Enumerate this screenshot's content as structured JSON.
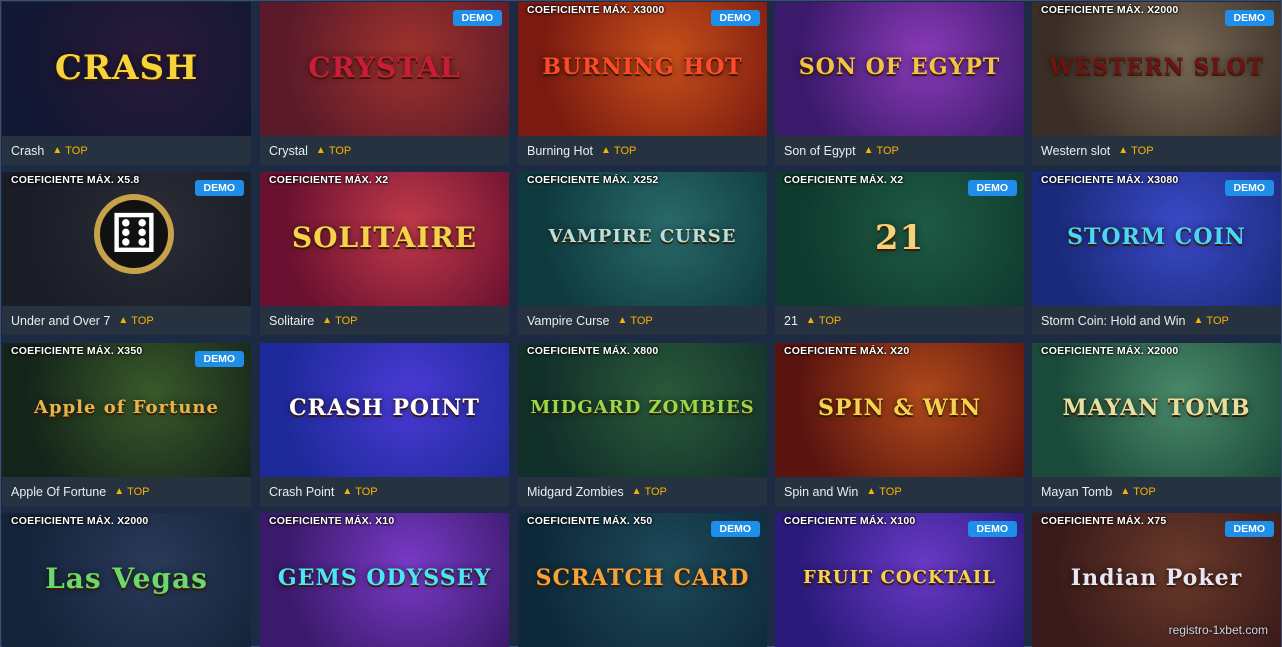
{
  "games": [
    {
      "name": "Crash",
      "badge": "TOP",
      "coef": "",
      "demo": false,
      "logo": "CRASH",
      "bg": [
        "#121733",
        "#2a1a3a"
      ],
      "logo_color": "#f6d33b"
    },
    {
      "name": "Crystal",
      "badge": "TOP",
      "coef": "",
      "demo": true,
      "logo": "CRYSTAL",
      "bg": [
        "#5a1a2a",
        "#a0322c"
      ],
      "logo_color": "#c81c3a"
    },
    {
      "name": "Burning Hot",
      "badge": "TOP",
      "coef": "COEFICIENTE MÁX. X3000",
      "demo": true,
      "logo": "BURNING HOT",
      "bg": [
        "#7a1a10",
        "#c8501a"
      ],
      "logo_color": "#ff4a2a"
    },
    {
      "name": "Son of Egypt",
      "badge": "TOP",
      "coef": "",
      "demo": false,
      "logo": "SON OF EGYPT",
      "bg": [
        "#3a1a6a",
        "#8a3ab8"
      ],
      "logo_color": "#f3c343"
    },
    {
      "name": "Western slot",
      "badge": "TOP",
      "coef": "COEFICIENTE MÁX. X2000",
      "demo": true,
      "logo": "WESTERN SLOT",
      "bg": [
        "#3a2e26",
        "#7a6a58"
      ],
      "logo_color": "#6a1414"
    },
    {
      "name": "Under and Over 7",
      "badge": "TOP",
      "coef": "COEFICIENTE MÁX. X5.8",
      "demo": true,
      "logo": "",
      "bg": [
        "#1a1c26",
        "#2a2c36"
      ],
      "logo_color": "#c6a24a"
    },
    {
      "name": "Solitaire",
      "badge": "TOP",
      "coef": "COEFICIENTE MÁX. X2",
      "demo": false,
      "logo": "SOLITAIRE",
      "bg": [
        "#6a1030",
        "#c23a4a"
      ],
      "logo_color": "#f6d34a"
    },
    {
      "name": "Vampire Curse",
      "badge": "TOP",
      "coef": "COEFICIENTE MÁX. X252",
      "demo": false,
      "logo": "VAMPIRE CURSE",
      "bg": [
        "#0e3a3e",
        "#2a6a6a"
      ],
      "logo_color": "#b8e0d8"
    },
    {
      "name": "21",
      "badge": "TOP",
      "coef": "COEFICIENTE MÁX. X2",
      "demo": true,
      "logo": "21",
      "bg": [
        "#0f3a2e",
        "#1e5a44"
      ],
      "logo_color": "#f3d27a"
    },
    {
      "name": "Storm Coin: Hold and Win",
      "badge": "TOP",
      "coef": "COEFICIENTE MÁX. X3080",
      "demo": true,
      "logo": "STORM COIN",
      "bg": [
        "#1a2a7a",
        "#3a4ac8"
      ],
      "logo_color": "#4ad6f6"
    },
    {
      "name": "Apple Of Fortune",
      "badge": "TOP",
      "coef": "COEFICIENTE MÁX. X350",
      "demo": true,
      "logo": "Apple of Fortune",
      "bg": [
        "#14241a",
        "#3a5a2a"
      ],
      "logo_color": "#e6b44a"
    },
    {
      "name": "Crash Point",
      "badge": "TOP",
      "coef": "",
      "demo": false,
      "logo": "CRASH POINT",
      "bg": [
        "#1e2a9a",
        "#4a3ad6"
      ],
      "logo_color": "#ffffff"
    },
    {
      "name": "Midgard Zombies",
      "badge": "TOP",
      "coef": "COEFICIENTE MÁX. X800",
      "demo": false,
      "logo": "MIDGARD ZOMBIES",
      "bg": [
        "#12302a",
        "#2a5a3a"
      ],
      "logo_color": "#9ad84a"
    },
    {
      "name": "Spin and Win",
      "badge": "TOP",
      "coef": "COEFICIENTE MÁX. X20",
      "demo": false,
      "logo": "SPIN & WIN",
      "bg": [
        "#5a1410",
        "#b04a1a"
      ],
      "logo_color": "#f6d34a"
    },
    {
      "name": "Mayan Tomb",
      "badge": "TOP",
      "coef": "COEFICIENTE MÁX. X2000",
      "demo": false,
      "logo": "MAYAN TOMB",
      "bg": [
        "#1a4a3a",
        "#4a8a6a"
      ],
      "logo_color": "#e6e0a0"
    },
    {
      "name": "",
      "badge": "",
      "coef": "COEFICIENTE MÁX. X2000",
      "demo": false,
      "logo": "Las Vegas",
      "bg": [
        "#14243a",
        "#2a3a5a"
      ],
      "logo_color": "#6ad86a"
    },
    {
      "name": "",
      "badge": "",
      "coef": "COEFICIENTE MÁX. X10",
      "demo": false,
      "logo": "GEMS ODYSSEY",
      "bg": [
        "#3a1a6a",
        "#7a3ac8"
      ],
      "logo_color": "#4ae6f6"
    },
    {
      "name": "",
      "badge": "",
      "coef": "COEFICIENTE MÁX. X50",
      "demo": true,
      "logo": "SCRATCH CARD",
      "bg": [
        "#0e2a3a",
        "#1e4a5a"
      ],
      "logo_color": "#f3a33a"
    },
    {
      "name": "",
      "badge": "",
      "coef": "COEFICIENTE MÁX. X100",
      "demo": true,
      "logo": "FRUIT COCKTAIL",
      "bg": [
        "#2a1a7a",
        "#6a3ac8"
      ],
      "logo_color": "#f6d34a"
    },
    {
      "name": "",
      "badge": "",
      "coef": "COEFICIENTE MÁX. X75",
      "demo": true,
      "logo": "Indian Poker",
      "bg": [
        "#3a1a1a",
        "#6a3a2a"
      ],
      "logo_color": "#e6e6f6"
    }
  ],
  "labels": {
    "demo": "DEMO",
    "top_icon": "flame-icon"
  },
  "watermark": "registro-1xbet.com"
}
